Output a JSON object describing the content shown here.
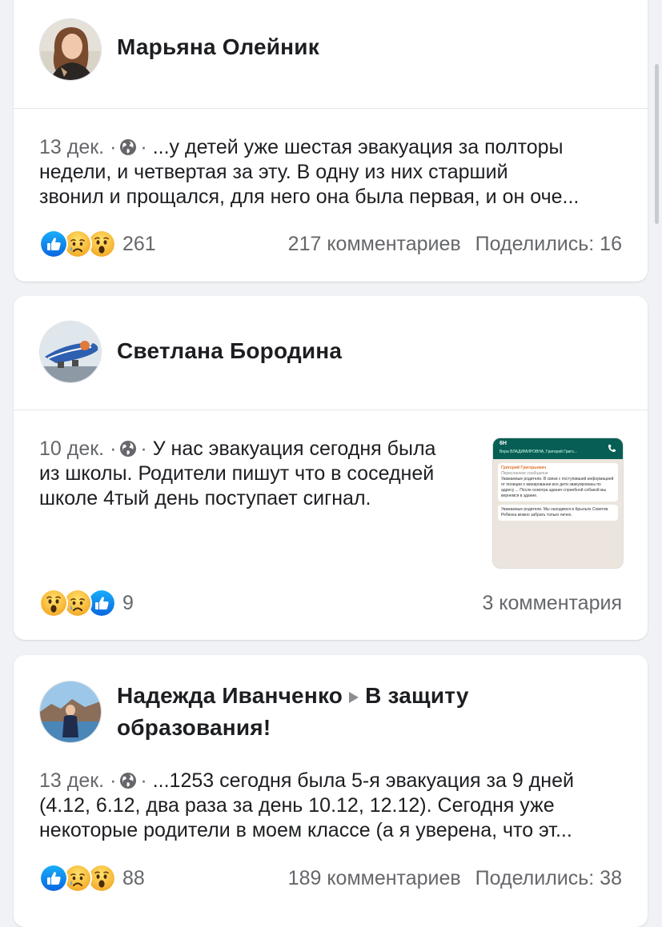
{
  "posts": [
    {
      "author": "Марьяна Олейник",
      "date": "13 дек.",
      "sep1": "·",
      "sep2": "·",
      "text_line1": "...у детей уже шестая эвакуация за полторы",
      "text_line2": "недели, и четвертая за эту.  В одну из них старший",
      "text_line3": "звонил и прощался, для него она была первая, и он оче...",
      "reactions": [
        "like-icon",
        "sad-icon",
        "wow-icon"
      ],
      "reaction_count": "261",
      "comments": "217 комментариев",
      "shares": "Поделились: 16"
    },
    {
      "author": "Светлана Бородина",
      "date": "10 дек.",
      "sep1": "·",
      "sep2": "·",
      "text_line1": "У нас эвакуация сегодня была",
      "text_line2": "из школы. Родители пишут что в соседней",
      "text_line3": "школе 4тый день поступает сигнал.",
      "reactions": [
        "wow-icon",
        "sad-icon",
        "like-icon"
      ],
      "reaction_count": "9",
      "comments": "3 комментария",
      "thumbnail": {
        "chat_name": "6Н",
        "chat_members": "Вера ВЛАДИМИРОВНА, Григорий Григо...",
        "sender": "Григорий Григорьевич",
        "forwarded": "Пересланное сообщение",
        "msg1": "Уважаемые родители. В связи с поступившей информацией от полиции о минировании все дети эвакуированы по адресу ... После осмотра здания служебной собакой мы вернемся в здание.",
        "msg2": "Уважаемые родители. Мы находимся в Крыльях Советов. Ребенка можно забрать только лично."
      }
    },
    {
      "author": "Надежда Иванченко",
      "group": "В защиту образования!",
      "group_line1": "В защиту",
      "group_line2": "образования!",
      "date": "13 дек.",
      "sep1": "·",
      "sep2": "·",
      "text_line1": "...1253 сегодня была 5-я эвакуация за 9 дней",
      "text_line2": "(4.12, 6.12, два раза за день 10.12, 12.12).  Сегодня уже",
      "text_line3": "некоторые родители в моем классе (а я уверена, что эт...",
      "reactions": [
        "like-icon",
        "sad-icon",
        "wow-icon"
      ],
      "reaction_count": "88",
      "comments": "189 комментариев",
      "shares": "Поделились: 38"
    }
  ],
  "colors": {
    "background": "#f0f2f5",
    "card": "#ffffff",
    "meta_text": "#65676b",
    "like_blue": "#1877f2",
    "emoji_yellow": "#f7b125"
  }
}
